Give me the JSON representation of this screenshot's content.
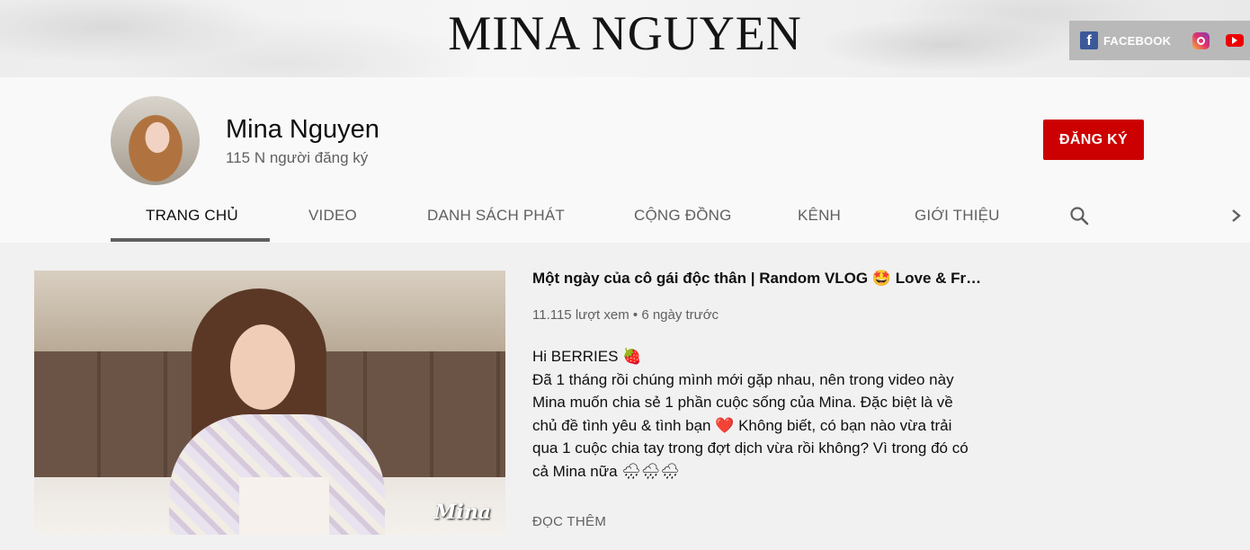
{
  "banner": {
    "title": "MINA NGUYEN",
    "social": {
      "facebook_label": "FACEBOOK",
      "icons": [
        "facebook-icon",
        "instagram-icon",
        "youtube-icon"
      ]
    }
  },
  "channel": {
    "name": "Mina Nguyen",
    "subscribers": "115 N người đăng ký",
    "subscribe_label": "ĐĂNG KÝ"
  },
  "tabs": [
    {
      "label": "TRANG CHỦ",
      "active": true
    },
    {
      "label": "VIDEO"
    },
    {
      "label": "DANH SÁCH PHÁT"
    },
    {
      "label": "CỘNG ĐỒNG"
    },
    {
      "label": "KÊNH"
    },
    {
      "label": "GIỚI THIỆU"
    }
  ],
  "featured": {
    "watermark": "Mina",
    "title": "Một ngày của cô gái độc thân | Random VLOG 🤩 Love & Frien…",
    "views": "11.115 lượt xem",
    "separator": "•",
    "age": "6 ngày trước",
    "description_lines": [
      "Hi BERRIES 🍓",
      "Đã 1 tháng rồi chúng mình mới gặp nhau, nên trong video này",
      "Mina muốn chia sẻ 1 phần cuộc sống của Mina. Đặc biệt là về",
      "chủ đề tình yêu & tình bạn ❤️ Không biết, có bạn nào vừa trải",
      "qua 1 cuộc chia tay trong đợt dịch vừa rồi không? Vì trong đó có",
      "cả Mina nữa 🌧🌧🌧"
    ],
    "read_more": "ĐỌC THÊM"
  },
  "colors": {
    "subscribe": "#cc0000",
    "page_bg": "#f1f1f1",
    "header_bg": "#f9f9f9",
    "social_bar": "#b9b9b9"
  }
}
